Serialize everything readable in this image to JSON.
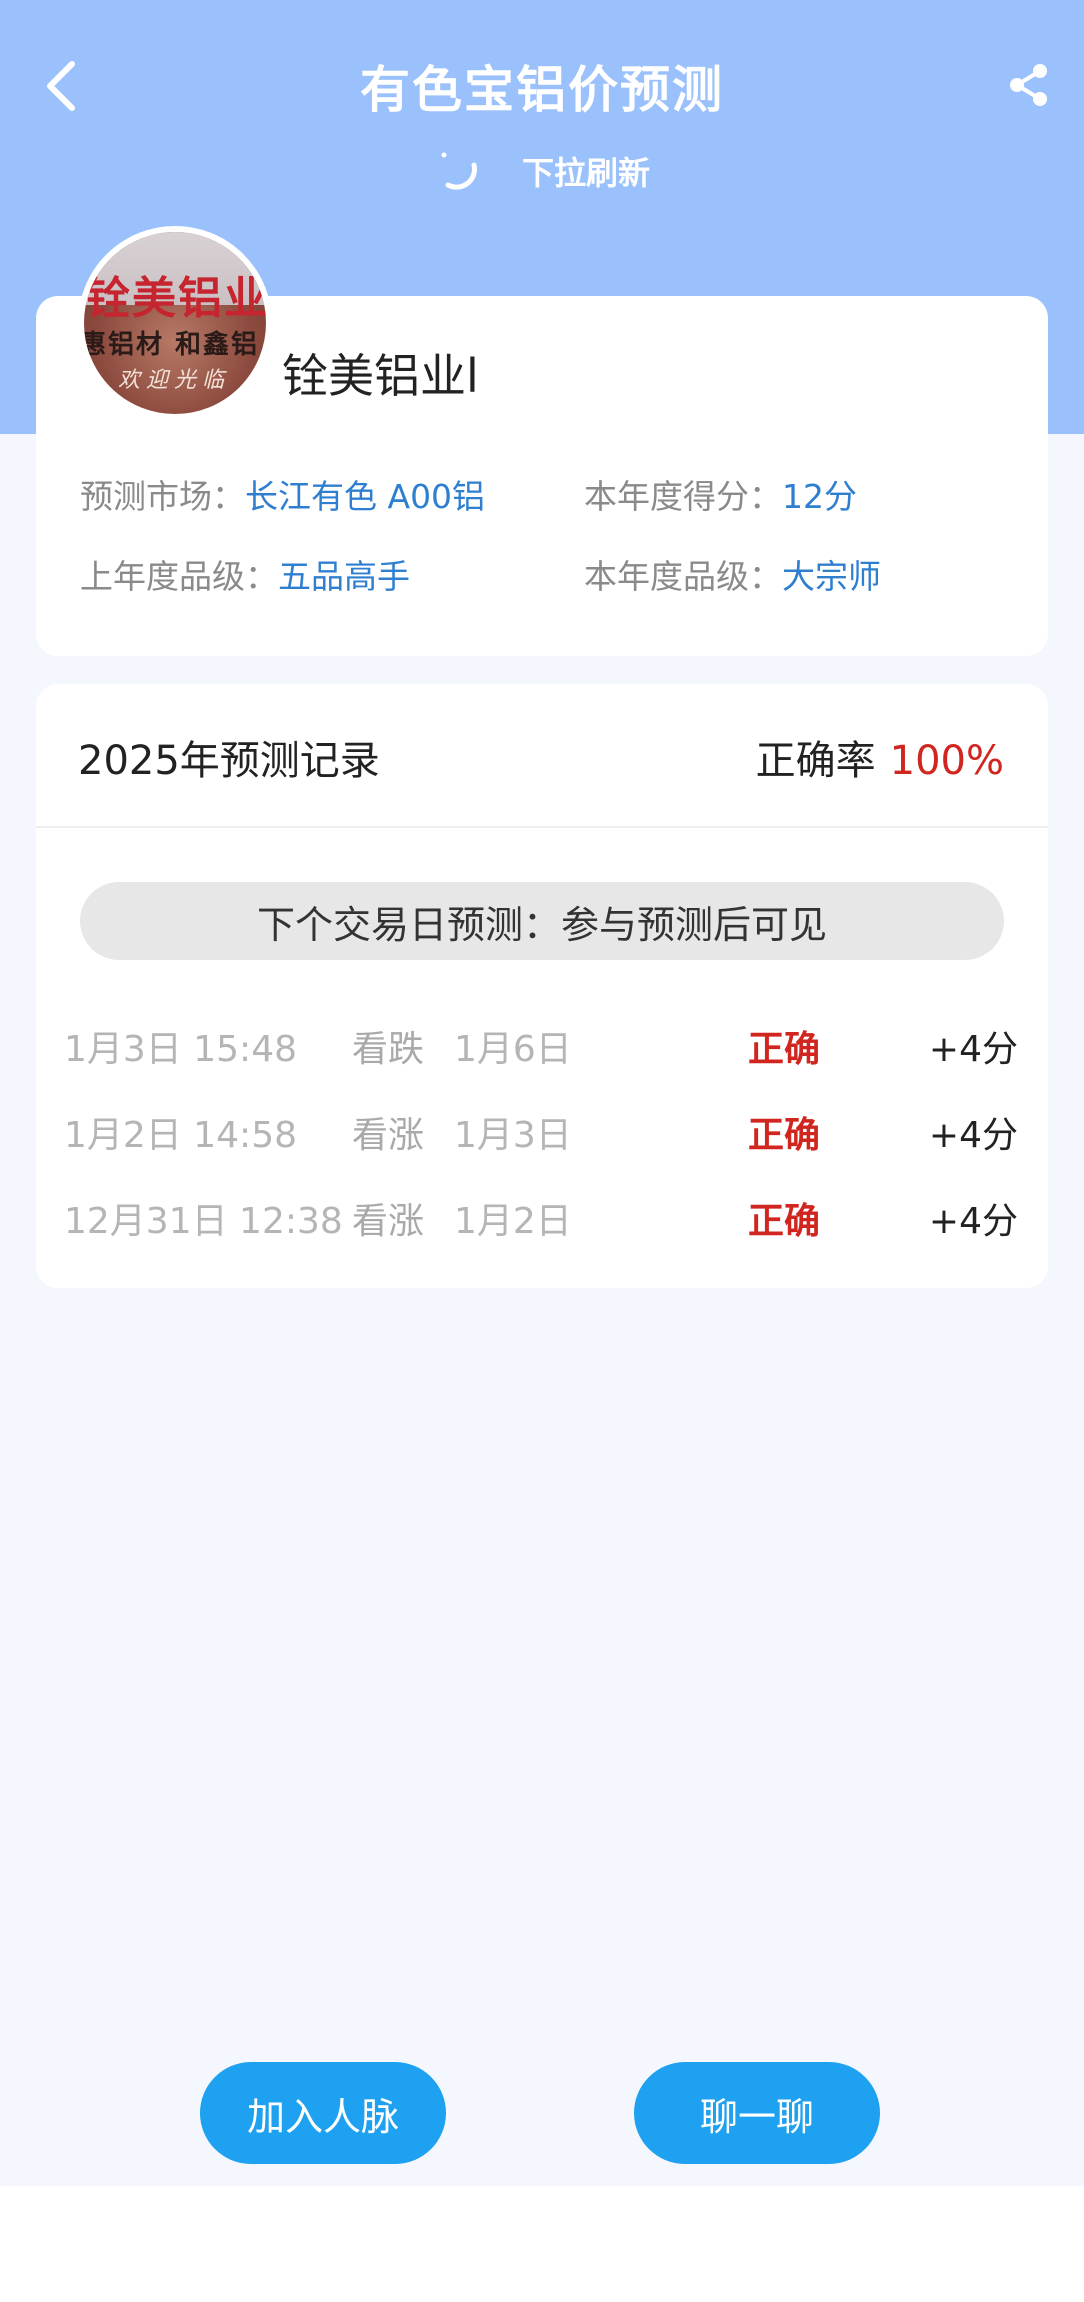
{
  "header": {
    "title": "有色宝铝价预测",
    "refresh_text": "下拉刷新"
  },
  "profile": {
    "avatar_text": [
      "铨美铝业",
      "惠铝材 和鑫铝",
      "欢迎光临"
    ],
    "name": "铨美铝业l",
    "market_label": "预测市场：",
    "market_value": "长江有色 A00铝",
    "score_label": "本年度得分：",
    "score_value": "12分",
    "last_grade_label": "上年度品级：",
    "last_grade_value": "五品高手",
    "grade_label": "本年度品级：",
    "grade_value": "大宗师"
  },
  "records": {
    "title": "2025年预测记录",
    "accuracy_label": "正确率",
    "accuracy_value": "100%",
    "next_prediction": "下个交易日预测：参与预测后可见",
    "rows": [
      {
        "date": "1月3日 15:48",
        "direction": "看跌",
        "target": "1月6日",
        "result": "正确",
        "score": "+4分"
      },
      {
        "date": "1月2日 14:58",
        "direction": "看涨",
        "target": "1月3日",
        "result": "正确",
        "score": "+4分"
      },
      {
        "date": "12月31日 12:38",
        "direction": "看涨",
        "target": "1月2日",
        "result": "正确",
        "score": "+4分"
      }
    ]
  },
  "actions": {
    "add_contact": "加入人脉",
    "chat": "聊一聊"
  },
  "colors": {
    "header_bg": "#9bc1fd",
    "accent_blue": "#2f7fd0",
    "correct_red": "#d0261f",
    "button_blue": "#1da1f0"
  },
  "icons": [
    "back-arrow-icon",
    "share-icon",
    "loading-spinner-icon"
  ]
}
